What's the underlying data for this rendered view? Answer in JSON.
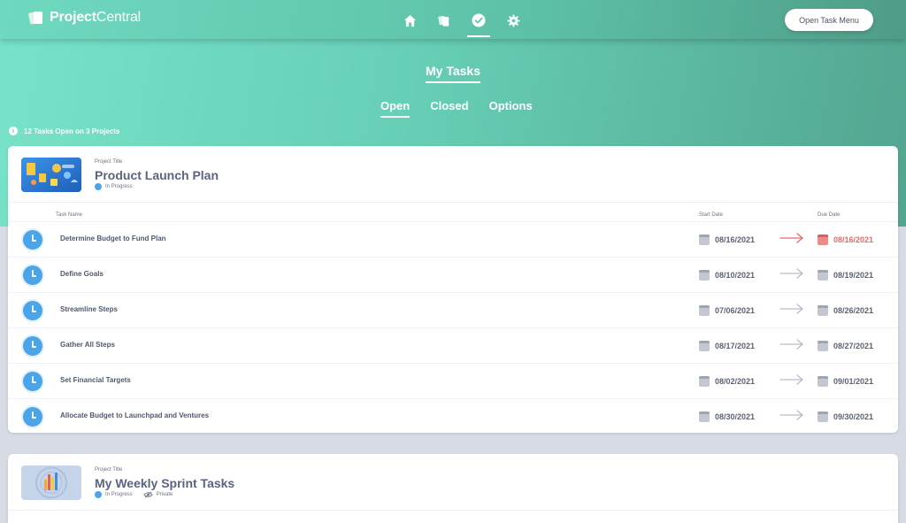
{
  "app": {
    "logo_bold": "Project",
    "logo_light": "Central",
    "open_task_menu_label": "Open Task Menu",
    "nav_icons": [
      "home-icon",
      "documents-icon",
      "check-circle-icon",
      "gear-icon"
    ]
  },
  "page": {
    "title": "My Tasks",
    "tabs": [
      {
        "label": "Open",
        "active": true
      },
      {
        "label": "Closed",
        "active": false
      },
      {
        "label": "Options",
        "active": false
      }
    ],
    "summary": "12 Tasks Open on 3 Projects"
  },
  "colors": {
    "accent": "#66cfb5",
    "clock_blue": "#4aa4ea",
    "overdue_red": "#e76a6a"
  },
  "project1": {
    "label": "Project Title",
    "name": "Product Launch Plan",
    "status": "In Progress",
    "columns": {
      "task": "Task Name",
      "start": "Start Date",
      "due": "Due Date"
    },
    "tasks": [
      {
        "name": "Determine Budget to Fund Plan",
        "start": "08/16/2021",
        "due": "08/16/2021",
        "overdue": true
      },
      {
        "name": "Define Goals",
        "start": "08/10/2021",
        "due": "08/19/2021",
        "overdue": false
      },
      {
        "name": "Streamline Steps",
        "start": "07/06/2021",
        "due": "08/26/2021",
        "overdue": false
      },
      {
        "name": "Gather All Steps",
        "start": "08/17/2021",
        "due": "08/27/2021",
        "overdue": false
      },
      {
        "name": "Set Financial Targets",
        "start": "08/02/2021",
        "due": "09/01/2021",
        "overdue": false
      },
      {
        "name": "Allocate Budget to Launchpad and Ventures",
        "start": "08/30/2021",
        "due": "09/30/2021",
        "overdue": false
      }
    ]
  },
  "project2": {
    "label": "Project Title",
    "name": "My Weekly Sprint Tasks",
    "status": "In Progress",
    "visibility": "Private"
  }
}
